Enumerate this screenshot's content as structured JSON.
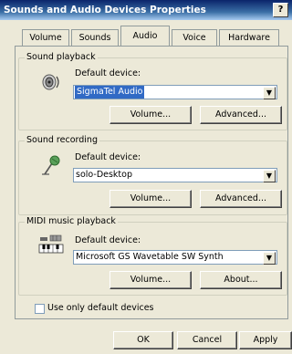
{
  "window": {
    "title": "Sounds and Audio Devices Properties",
    "help": "?"
  },
  "tabs": [
    {
      "label": "Volume"
    },
    {
      "label": "Sounds"
    },
    {
      "label": "Audio"
    },
    {
      "label": "Voice"
    },
    {
      "label": "Hardware"
    }
  ],
  "playback": {
    "group_label": "Sound playback",
    "default_label": "Default device:",
    "device": "SigmaTel Audio",
    "volume_button": "Volume...",
    "advanced_button": "Advanced..."
  },
  "recording": {
    "group_label": "Sound recording",
    "default_label": "Default device:",
    "device": "solo-Desktop",
    "volume_button": "Volume...",
    "advanced_button": "Advanced..."
  },
  "midi": {
    "group_label": "MIDI music playback",
    "default_label": "Default device:",
    "device": "Microsoft GS Wavetable SW Synth",
    "volume_button": "Volume...",
    "about_button": "About..."
  },
  "options": {
    "use_default_label": "Use only default devices",
    "use_default_checked": false
  },
  "footer": {
    "ok": "OK",
    "cancel": "Cancel",
    "apply": "Apply"
  }
}
